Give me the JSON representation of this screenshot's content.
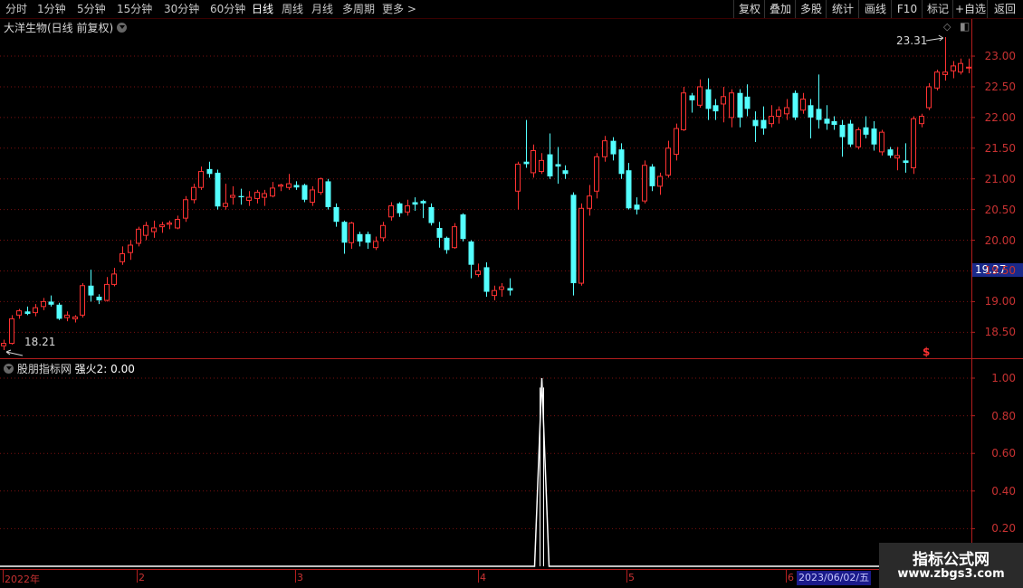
{
  "toolbar": {
    "periods": [
      "分时",
      "1分钟",
      "5分钟",
      "15分钟",
      "30分钟",
      "60分钟",
      "日线",
      "周线",
      "月线",
      "多周期",
      "更多 >"
    ],
    "active_period": "日线",
    "right_buttons": [
      "复权",
      "叠加",
      "多股",
      "统计",
      "画线",
      "F10",
      "标记",
      "+自选",
      "返回"
    ]
  },
  "main_panel": {
    "title": "大洋生物(日线 前复权)",
    "high_marker": "23.31",
    "low_marker": "18.21",
    "current_price_tag": "19.27",
    "dollar_marker": "$",
    "y_ticks": [
      "23.00",
      "22.50",
      "22.00",
      "21.50",
      "21.00",
      "20.50",
      "20.00",
      "19.50",
      "19.00",
      "18.50"
    ]
  },
  "sub_panel": {
    "title": "股朋指标网",
    "indicator_label": "强火2: 0.00",
    "y_ticks": [
      "1.00",
      "0.80",
      "0.60",
      "0.40",
      "0.20"
    ]
  },
  "x_axis": {
    "labels": [
      "2022年",
      "2",
      "3",
      "4",
      "5",
      "6"
    ],
    "cursor_date": "2023/06/02/五"
  },
  "watermark": {
    "title": "指标公式网",
    "url": "www.zbgs3.com"
  },
  "colors": {
    "up": "#ff3232",
    "down": "#54ffff",
    "grid": "#7a1010",
    "axis": "#b41e1e",
    "indicator_line": "#ffffff"
  },
  "chart_data": {
    "type": "candlestick",
    "ylim": [
      18.2,
      23.3
    ],
    "candles": [
      {
        "o": 18.28,
        "h": 18.38,
        "l": 18.21,
        "c": 18.32
      },
      {
        "o": 18.32,
        "h": 18.78,
        "l": 18.3,
        "c": 18.72
      },
      {
        "o": 18.78,
        "h": 18.88,
        "l": 18.72,
        "c": 18.85
      },
      {
        "o": 18.84,
        "h": 18.92,
        "l": 18.78,
        "c": 18.8
      },
      {
        "o": 18.82,
        "h": 18.96,
        "l": 18.76,
        "c": 18.9
      },
      {
        "o": 18.92,
        "h": 19.06,
        "l": 18.86,
        "c": 19.0
      },
      {
        "o": 19.0,
        "h": 19.1,
        "l": 18.92,
        "c": 18.95
      },
      {
        "o": 18.95,
        "h": 18.98,
        "l": 18.7,
        "c": 18.72
      },
      {
        "o": 18.74,
        "h": 18.84,
        "l": 18.68,
        "c": 18.78
      },
      {
        "o": 18.72,
        "h": 18.78,
        "l": 18.66,
        "c": 18.75
      },
      {
        "o": 18.78,
        "h": 19.3,
        "l": 18.74,
        "c": 19.26
      },
      {
        "o": 19.26,
        "h": 19.52,
        "l": 19.0,
        "c": 19.1
      },
      {
        "o": 19.08,
        "h": 19.12,
        "l": 18.96,
        "c": 19.02
      },
      {
        "o": 19.02,
        "h": 19.4,
        "l": 19.0,
        "c": 19.28
      },
      {
        "o": 19.28,
        "h": 19.55,
        "l": 19.25,
        "c": 19.45
      },
      {
        "o": 19.65,
        "h": 19.9,
        "l": 19.6,
        "c": 19.78
      },
      {
        "o": 19.8,
        "h": 20.0,
        "l": 19.68,
        "c": 19.92
      },
      {
        "o": 19.95,
        "h": 20.22,
        "l": 19.9,
        "c": 20.18
      },
      {
        "o": 20.08,
        "h": 20.3,
        "l": 20.0,
        "c": 20.24
      },
      {
        "o": 20.14,
        "h": 20.32,
        "l": 20.04,
        "c": 20.2
      },
      {
        "o": 20.22,
        "h": 20.3,
        "l": 20.12,
        "c": 20.25
      },
      {
        "o": 20.26,
        "h": 20.32,
        "l": 20.18,
        "c": 20.28
      },
      {
        "o": 20.2,
        "h": 20.4,
        "l": 20.18,
        "c": 20.34
      },
      {
        "o": 20.36,
        "h": 20.72,
        "l": 20.3,
        "c": 20.66
      },
      {
        "o": 20.66,
        "h": 20.92,
        "l": 20.6,
        "c": 20.86
      },
      {
        "o": 20.86,
        "h": 21.2,
        "l": 20.82,
        "c": 21.12
      },
      {
        "o": 21.16,
        "h": 21.28,
        "l": 21.02,
        "c": 21.08
      },
      {
        "o": 21.1,
        "h": 21.15,
        "l": 20.5,
        "c": 20.55
      },
      {
        "o": 20.55,
        "h": 20.92,
        "l": 20.5,
        "c": 20.6
      },
      {
        "o": 20.7,
        "h": 20.88,
        "l": 20.58,
        "c": 20.73
      },
      {
        "o": 20.72,
        "h": 20.84,
        "l": 20.58,
        "c": 20.7
      },
      {
        "o": 20.65,
        "h": 20.8,
        "l": 20.56,
        "c": 20.7
      },
      {
        "o": 20.68,
        "h": 20.82,
        "l": 20.6,
        "c": 20.78
      },
      {
        "o": 20.7,
        "h": 20.82,
        "l": 20.56,
        "c": 20.76
      },
      {
        "o": 20.72,
        "h": 20.95,
        "l": 20.7,
        "c": 20.85
      },
      {
        "o": 20.88,
        "h": 20.92,
        "l": 20.8,
        "c": 20.9
      },
      {
        "o": 20.86,
        "h": 21.08,
        "l": 20.82,
        "c": 20.92
      },
      {
        "o": 20.9,
        "h": 20.96,
        "l": 20.82,
        "c": 20.86
      },
      {
        "o": 20.9,
        "h": 20.92,
        "l": 20.62,
        "c": 20.66
      },
      {
        "o": 20.62,
        "h": 20.88,
        "l": 20.56,
        "c": 20.82
      },
      {
        "o": 20.78,
        "h": 21.02,
        "l": 20.74,
        "c": 21.0
      },
      {
        "o": 20.96,
        "h": 21.0,
        "l": 20.5,
        "c": 20.54
      },
      {
        "o": 20.54,
        "h": 20.6,
        "l": 20.22,
        "c": 20.3
      },
      {
        "o": 20.3,
        "h": 20.32,
        "l": 19.78,
        "c": 19.96
      },
      {
        "o": 19.96,
        "h": 20.3,
        "l": 19.86,
        "c": 20.28
      },
      {
        "o": 20.1,
        "h": 20.14,
        "l": 19.9,
        "c": 19.98
      },
      {
        "o": 20.1,
        "h": 20.14,
        "l": 19.86,
        "c": 19.96
      },
      {
        "o": 19.88,
        "h": 20.06,
        "l": 19.84,
        "c": 19.98
      },
      {
        "o": 20.04,
        "h": 20.3,
        "l": 19.98,
        "c": 20.24
      },
      {
        "o": 20.38,
        "h": 20.62,
        "l": 20.32,
        "c": 20.56
      },
      {
        "o": 20.6,
        "h": 20.62,
        "l": 20.38,
        "c": 20.44
      },
      {
        "o": 20.46,
        "h": 20.66,
        "l": 20.4,
        "c": 20.56
      },
      {
        "o": 20.62,
        "h": 20.7,
        "l": 20.48,
        "c": 20.58
      },
      {
        "o": 20.64,
        "h": 20.66,
        "l": 20.36,
        "c": 20.6
      },
      {
        "o": 20.54,
        "h": 20.6,
        "l": 20.24,
        "c": 20.28
      },
      {
        "o": 20.2,
        "h": 20.3,
        "l": 19.88,
        "c": 20.04
      },
      {
        "o": 20.04,
        "h": 20.06,
        "l": 19.78,
        "c": 19.84
      },
      {
        "o": 19.88,
        "h": 20.28,
        "l": 19.86,
        "c": 20.22
      },
      {
        "o": 20.42,
        "h": 20.44,
        "l": 19.98,
        "c": 20.02
      },
      {
        "o": 19.98,
        "h": 20.0,
        "l": 19.38,
        "c": 19.6
      },
      {
        "o": 19.44,
        "h": 19.62,
        "l": 19.4,
        "c": 19.5
      },
      {
        "o": 19.56,
        "h": 19.64,
        "l": 19.08,
        "c": 19.16
      },
      {
        "o": 19.1,
        "h": 19.26,
        "l": 19.02,
        "c": 19.18
      },
      {
        "o": 19.2,
        "h": 19.3,
        "l": 19.08,
        "c": 19.24
      },
      {
        "o": 19.22,
        "h": 19.38,
        "l": 19.1,
        "c": 19.18
      },
      {
        "o": 20.8,
        "h": 21.28,
        "l": 20.5,
        "c": 21.24
      },
      {
        "o": 21.28,
        "h": 21.96,
        "l": 21.18,
        "c": 21.24
      },
      {
        "o": 21.1,
        "h": 21.56,
        "l": 21.02,
        "c": 21.46
      },
      {
        "o": 21.12,
        "h": 21.42,
        "l": 21.08,
        "c": 21.3
      },
      {
        "o": 21.4,
        "h": 21.74,
        "l": 21.0,
        "c": 21.04
      },
      {
        "o": 21.24,
        "h": 21.52,
        "l": 20.92,
        "c": 21.2
      },
      {
        "o": 21.14,
        "h": 21.22,
        "l": 21.0,
        "c": 21.08
      },
      {
        "o": 20.74,
        "h": 20.78,
        "l": 19.1,
        "c": 19.3
      },
      {
        "o": 19.3,
        "h": 20.6,
        "l": 19.26,
        "c": 20.52
      },
      {
        "o": 20.52,
        "h": 20.9,
        "l": 20.4,
        "c": 20.72
      },
      {
        "o": 20.8,
        "h": 21.42,
        "l": 20.68,
        "c": 21.36
      },
      {
        "o": 21.36,
        "h": 21.7,
        "l": 21.28,
        "c": 21.62
      },
      {
        "o": 21.62,
        "h": 21.68,
        "l": 21.3,
        "c": 21.4
      },
      {
        "o": 21.48,
        "h": 21.58,
        "l": 21.0,
        "c": 21.08
      },
      {
        "o": 21.14,
        "h": 21.26,
        "l": 20.5,
        "c": 20.52
      },
      {
        "o": 20.58,
        "h": 20.7,
        "l": 20.42,
        "c": 20.5
      },
      {
        "o": 20.64,
        "h": 21.3,
        "l": 20.6,
        "c": 21.22
      },
      {
        "o": 21.2,
        "h": 21.24,
        "l": 20.8,
        "c": 20.88
      },
      {
        "o": 20.88,
        "h": 21.1,
        "l": 20.74,
        "c": 21.04
      },
      {
        "o": 21.06,
        "h": 21.62,
        "l": 21.02,
        "c": 21.5
      },
      {
        "o": 21.4,
        "h": 21.9,
        "l": 21.3,
        "c": 21.82
      },
      {
        "o": 21.8,
        "h": 22.5,
        "l": 21.78,
        "c": 22.4
      },
      {
        "o": 22.36,
        "h": 22.4,
        "l": 22.08,
        "c": 22.28
      },
      {
        "o": 22.2,
        "h": 22.62,
        "l": 22.16,
        "c": 22.5
      },
      {
        "o": 22.46,
        "h": 22.64,
        "l": 21.96,
        "c": 22.14
      },
      {
        "o": 22.2,
        "h": 22.3,
        "l": 21.96,
        "c": 22.1
      },
      {
        "o": 22.22,
        "h": 22.5,
        "l": 21.92,
        "c": 22.34
      },
      {
        "o": 22.0,
        "h": 22.46,
        "l": 21.84,
        "c": 22.4
      },
      {
        "o": 22.4,
        "h": 22.46,
        "l": 21.84,
        "c": 22.0
      },
      {
        "o": 22.34,
        "h": 22.54,
        "l": 22.02,
        "c": 22.14
      },
      {
        "o": 21.96,
        "h": 22.1,
        "l": 21.6,
        "c": 21.86
      },
      {
        "o": 21.96,
        "h": 22.18,
        "l": 21.72,
        "c": 21.82
      },
      {
        "o": 21.9,
        "h": 22.2,
        "l": 21.84,
        "c": 22.02
      },
      {
        "o": 22.02,
        "h": 22.18,
        "l": 21.9,
        "c": 22.12
      },
      {
        "o": 22.06,
        "h": 22.3,
        "l": 21.96,
        "c": 22.16
      },
      {
        "o": 22.4,
        "h": 22.44,
        "l": 21.96,
        "c": 22.0
      },
      {
        "o": 22.12,
        "h": 22.4,
        "l": 22.06,
        "c": 22.3
      },
      {
        "o": 22.2,
        "h": 22.3,
        "l": 21.66,
        "c": 22.0
      },
      {
        "o": 22.14,
        "h": 22.7,
        "l": 21.82,
        "c": 21.96
      },
      {
        "o": 21.98,
        "h": 22.2,
        "l": 21.8,
        "c": 21.9
      },
      {
        "o": 21.94,
        "h": 22.02,
        "l": 21.8,
        "c": 21.88
      },
      {
        "o": 21.88,
        "h": 21.96,
        "l": 21.36,
        "c": 21.68
      },
      {
        "o": 21.9,
        "h": 21.96,
        "l": 21.52,
        "c": 21.56
      },
      {
        "o": 21.52,
        "h": 21.84,
        "l": 21.48,
        "c": 21.8
      },
      {
        "o": 21.84,
        "h": 22.02,
        "l": 21.66,
        "c": 21.72
      },
      {
        "o": 21.82,
        "h": 21.94,
        "l": 21.46,
        "c": 21.56
      },
      {
        "o": 21.44,
        "h": 21.8,
        "l": 21.38,
        "c": 21.76
      },
      {
        "o": 21.48,
        "h": 21.52,
        "l": 21.34,
        "c": 21.38
      },
      {
        "o": 21.34,
        "h": 21.52,
        "l": 21.14,
        "c": 21.38
      },
      {
        "o": 21.3,
        "h": 21.58,
        "l": 21.1,
        "c": 21.26
      },
      {
        "o": 21.18,
        "h": 22.02,
        "l": 21.08,
        "c": 21.98
      },
      {
        "o": 21.9,
        "h": 22.06,
        "l": 21.84,
        "c": 22.02
      },
      {
        "o": 22.16,
        "h": 22.56,
        "l": 22.12,
        "c": 22.5
      },
      {
        "o": 22.48,
        "h": 22.78,
        "l": 22.44,
        "c": 22.74
      },
      {
        "o": 22.7,
        "h": 23.31,
        "l": 22.6,
        "c": 22.74
      },
      {
        "o": 22.76,
        "h": 22.92,
        "l": 22.64,
        "c": 22.84
      },
      {
        "o": 22.74,
        "h": 22.96,
        "l": 22.7,
        "c": 22.88
      },
      {
        "o": 22.82,
        "h": 22.96,
        "l": 22.72,
        "c": 22.82
      }
    ],
    "indicator": {
      "name": "强火2",
      "ylim": [
        0,
        1.0
      ],
      "signal_index": 66,
      "signal_value": 1.0
    }
  }
}
